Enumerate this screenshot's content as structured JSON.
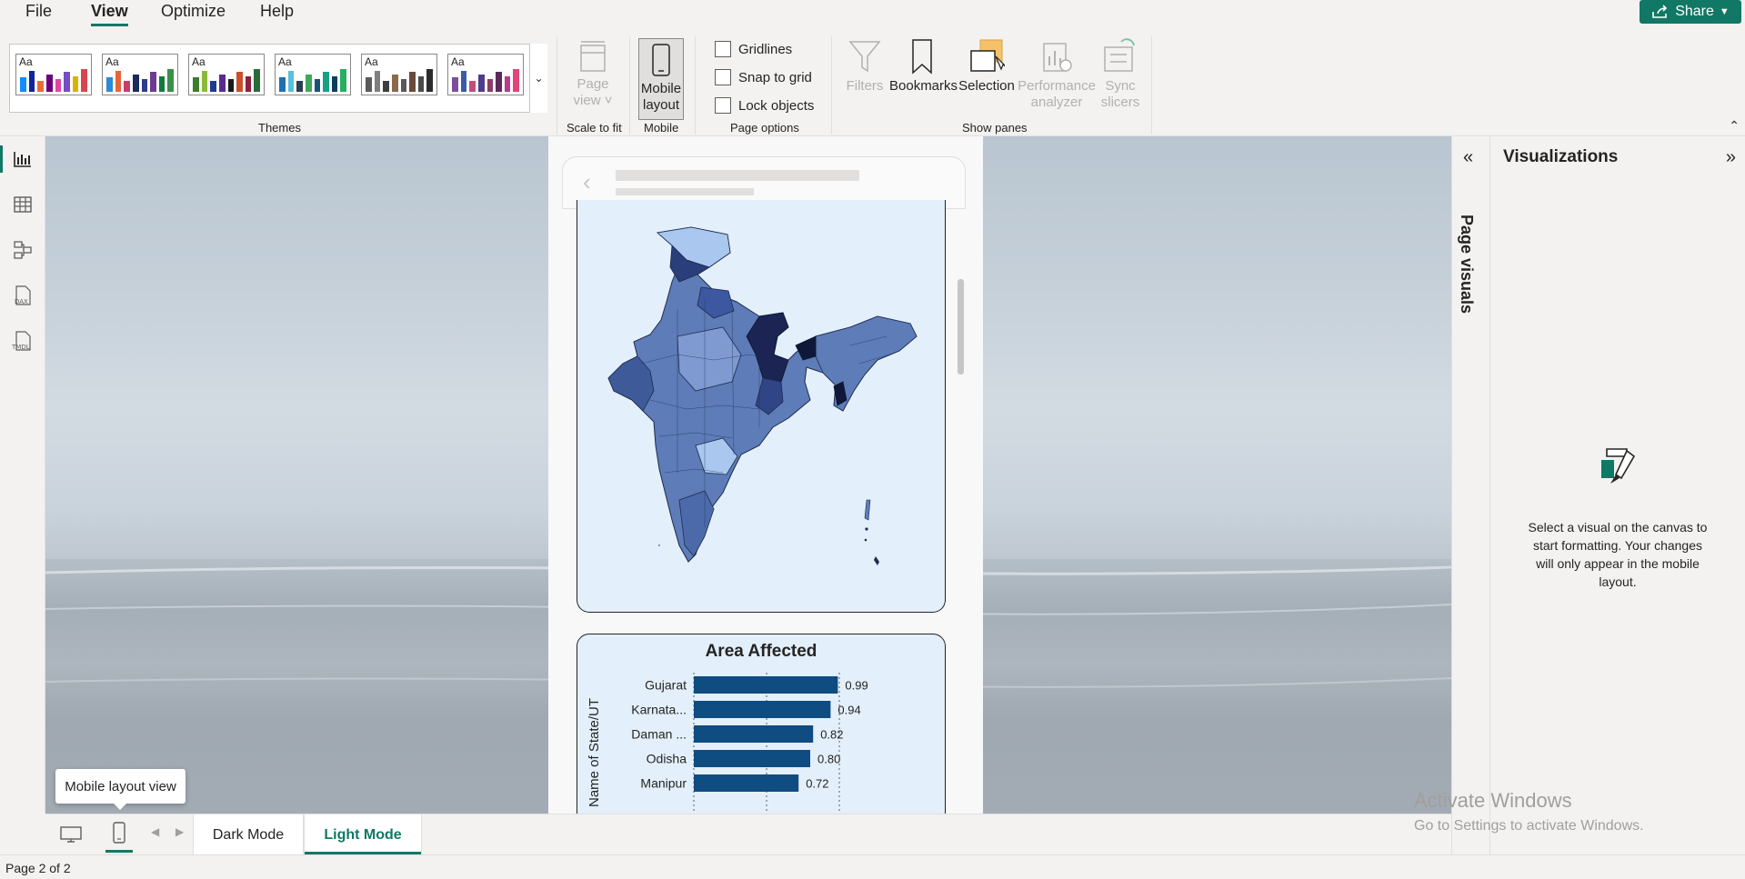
{
  "menu": {
    "items": [
      "File",
      "View",
      "Optimize",
      "Help"
    ],
    "active": "View",
    "share_label": "Share"
  },
  "ribbon": {
    "themes": {
      "label": "Themes",
      "swatches": [
        {
          "aa": "Aa",
          "colors": [
            "#118dff",
            "#12239e",
            "#e66c37",
            "#6b007b",
            "#e044a7",
            "#744ec2",
            "#d9b300",
            "#d64550"
          ]
        },
        {
          "aa": "Aa",
          "colors": [
            "#2c8bd6",
            "#e8643c",
            "#c93c6b",
            "#1b2a5b",
            "#2e3a8c",
            "#6d3b8f",
            "#0f7b3f",
            "#3a8f4a"
          ]
        },
        {
          "aa": "Aa",
          "colors": [
            "#3a7d2b",
            "#8bba3a",
            "#1d3b8f",
            "#5b2a8f",
            "#1a1a1a",
            "#c94f2b",
            "#8f1d3b",
            "#2b6b3a"
          ]
        },
        {
          "aa": "Aa",
          "colors": [
            "#1f6fb4",
            "#5bc0de",
            "#2c3e50",
            "#3fa85b",
            "#1a5276",
            "#16a085",
            "#0b3d5c",
            "#27ae60"
          ]
        },
        {
          "aa": "Aa",
          "colors": [
            "#5a5a5a",
            "#7f7f7f",
            "#3d3d3d",
            "#8a6a4a",
            "#595959",
            "#6b4a3a",
            "#4a4a4a",
            "#2b2b2b"
          ]
        },
        {
          "aa": "Aa",
          "colors": [
            "#7b4f9d",
            "#3b5ba9",
            "#c44d7a",
            "#4f3b8f",
            "#8f3b6b",
            "#5b2a5b",
            "#b83b8f",
            "#e0457b"
          ]
        }
      ]
    },
    "page_view": {
      "line1": "Page",
      "line2": "view ˅",
      "group": "Scale to fit"
    },
    "mobile_layout": {
      "line1": "Mobile",
      "line2": "layout",
      "group": "Mobile"
    },
    "page_options": {
      "items": [
        "Gridlines",
        "Snap to grid",
        "Lock objects"
      ],
      "group": "Page options"
    },
    "show_panes": {
      "group": "Show panes",
      "filters": "Filters",
      "bookmarks": "Bookmarks",
      "selection": "Selection",
      "performance_1": "Performance",
      "performance_2": "analyzer",
      "sync_1": "Sync",
      "sync_2": "slicers"
    }
  },
  "chart_data": {
    "type": "bar",
    "title": "Area Affected",
    "ylabel": "Name of State/UT",
    "xlabel": "",
    "categories": [
      "Gujarat",
      "Karnata...",
      "Daman ...",
      "Odisha",
      "Manipur"
    ],
    "values": [
      0.99,
      0.94,
      0.82,
      0.8,
      0.72
    ],
    "value_labels": [
      "0.99",
      "0.94",
      "0.82",
      "0.80",
      "0.72"
    ],
    "xlim": [
      0,
      1.2
    ],
    "grid": true,
    "bar_color": "#0f4c81"
  },
  "visualizations": {
    "title": "Visualizations",
    "page_visuals_label": "Page visuals",
    "message": "Select a visual on the canvas to start formatting. Your changes will only appear in the mobile layout."
  },
  "bottom": {
    "tooltip": "Mobile layout view",
    "tabs": [
      "Dark Mode",
      "Light Mode"
    ],
    "active_tab": "Light Mode"
  },
  "status": {
    "page": "Page 2 of 2"
  },
  "watermark": {
    "line1": "Activate Windows",
    "line2": "Go to Settings to activate Windows."
  },
  "colors": {
    "accent": "#117865",
    "bar": "#0f4c81",
    "card_bg": "#e3effa"
  }
}
